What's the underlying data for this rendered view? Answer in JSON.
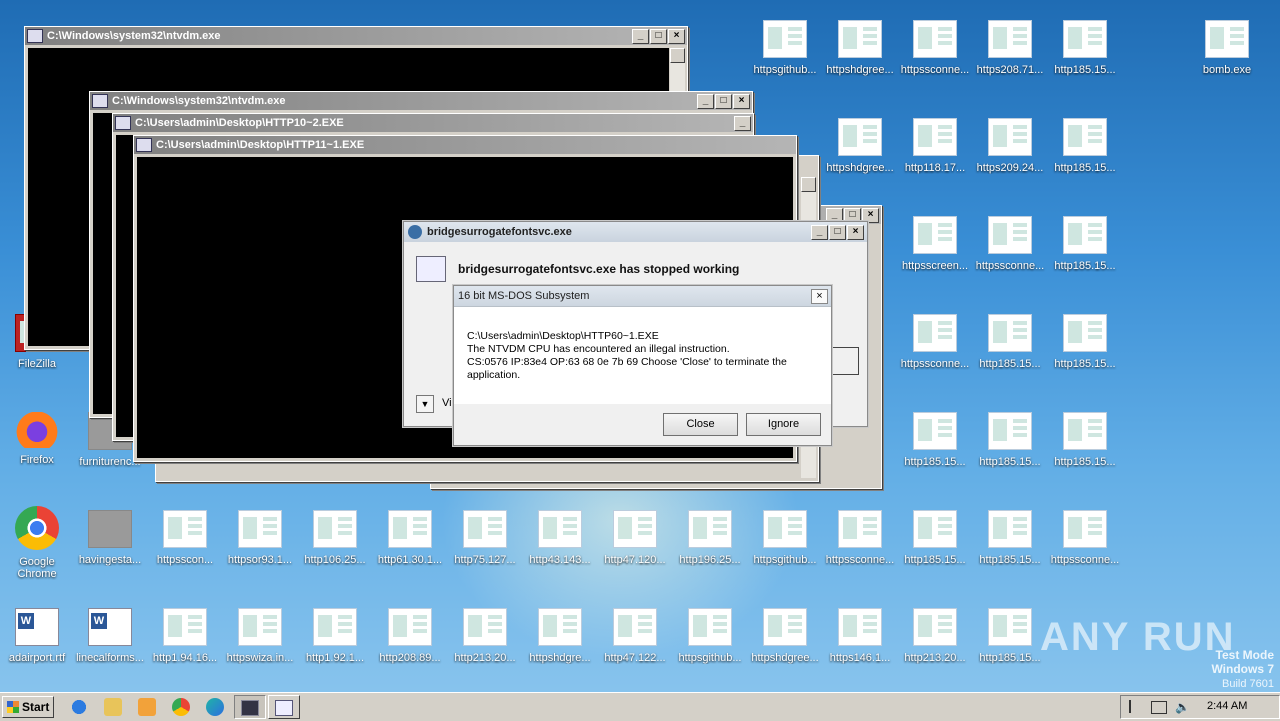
{
  "desktop_icons": {
    "bomb": "bomb.exe",
    "filezilla": "FileZilla",
    "firefox": "Firefox",
    "furniture": "furniturenc...",
    "chrome": "Google Chrome",
    "havinges": "havingesta...",
    "adairport": "adairport.rtf",
    "linecall": "linecalforms...",
    "row1": [
      "httpsgithub...",
      "httpshdgree...",
      "httpssconne...",
      "https208.71...",
      "http185.15..."
    ],
    "row2": [
      "httpshdgree...",
      "http118.17...",
      "https209.24...",
      "http185.15..."
    ],
    "row3": [
      "httpsscreen...",
      "httpssconne...",
      "http185.15..."
    ],
    "row4": [
      "httpssconne...",
      "http185.15...",
      "http185.15..."
    ],
    "row5": [
      "http185.15...",
      "http185.15...",
      "http185.15..."
    ],
    "row6": [
      "httpsscon...",
      "httpsor93.1...",
      "http106.25...",
      "http61.30.1...",
      "http75.127...",
      "http43.143...",
      "http47.120...",
      "http196.25...",
      "httpsgithub...",
      "httpssconne...",
      "http185.15...",
      "http185.15...",
      "httpssconne..."
    ],
    "row7": [
      "http1.94.16...",
      "httpswiza.in...",
      "http1.92.1...",
      "http208.89...",
      "http213.20...",
      "httpshdgre...",
      "http47.122...",
      "httpsgithub...",
      "httpshdgree...",
      "https146.1...",
      "http213.20...",
      "http185.15..."
    ]
  },
  "windows": {
    "ntvdm1_title": "C:\\Windows\\system32\\ntvdm.exe",
    "ntvdm2_title": "C:\\Windows\\system32\\ntvdm.exe",
    "http10_title": "C:\\Users\\admin\\Desktop\\HTTP10~2.EXE",
    "http11_title": "C:\\Users\\admin\\Desktop\\HTTP11~1.EXE"
  },
  "werdialog": {
    "title": "bridgesurrogatefontsvc.exe",
    "heading": "bridgesurrogatefontsvc.exe has stopped working",
    "view_label": "Vie"
  },
  "msdos": {
    "title": "16 bit MS-DOS Subsystem",
    "line1": "C:\\Users\\admin\\Desktop\\HTTP60~1.EXE",
    "line2": "The NTVDM CPU has encountered an illegal instruction.",
    "line3": "CS:0576 IP:83e4 OP:63 68 0e 7b 69 Choose 'Close' to terminate the",
    "line4": "application.",
    "close_label": "Close",
    "ignore_label": "Ignore"
  },
  "taskbar": {
    "start_label": "Start",
    "clock": "2:44 AM"
  },
  "watermark": {
    "brand": "ANY RUN",
    "mode": "Test Mode",
    "os": "Windows 7",
    "build": "Build 7601"
  }
}
